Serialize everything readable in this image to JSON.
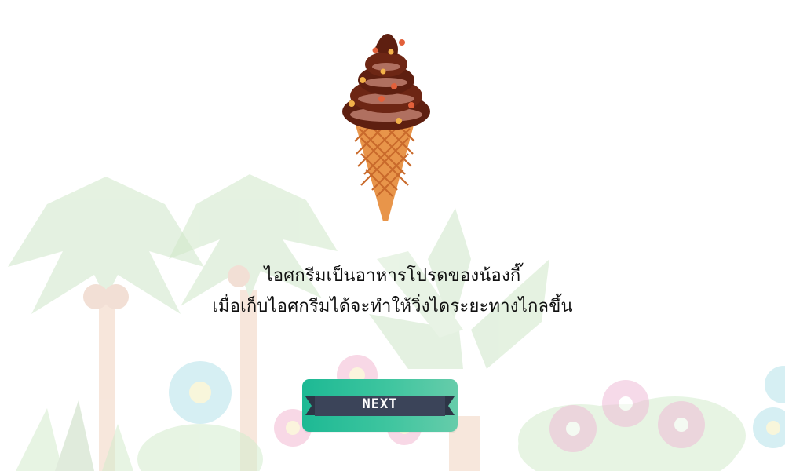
{
  "story": {
    "line1": "ไอศกรีมเป็นอาหารโปรดของน้องกี๊",
    "line2": "เมื่อเก็บไอศกรีมได้จะทำให้วิ่งไดระยะทางไกลขึ้น"
  },
  "buttons": {
    "next_label": "NEXT"
  },
  "item": {
    "icon": "ice-cream-cone-icon"
  },
  "colors": {
    "button_start": "#1db994",
    "button_end": "#66ccaa",
    "ribbon": "#3b4459",
    "chocolate": "#5e1f10",
    "cone": "#e8954a"
  }
}
